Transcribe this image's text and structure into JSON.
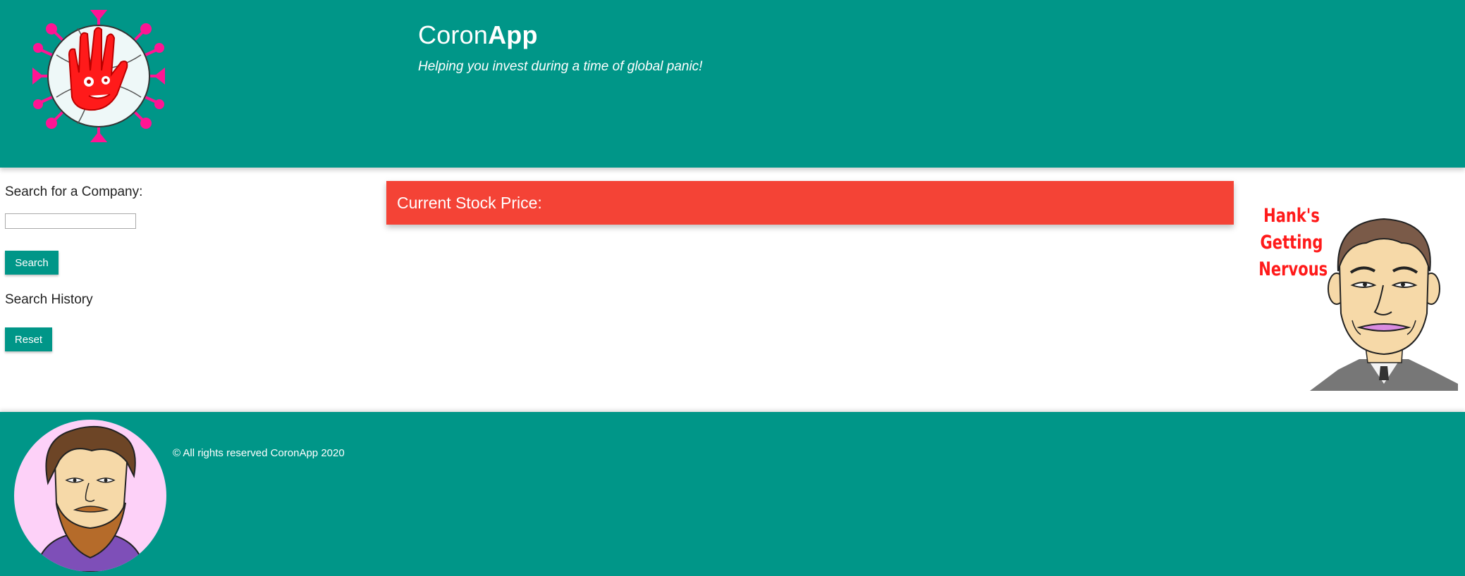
{
  "header": {
    "brand_light": "Coron",
    "brand_bold": "App",
    "tagline": "Helping you invest during a time of global panic!",
    "logo_icon": "virus-volleyball-logo-icon"
  },
  "sidebar": {
    "search_label": "Search for a Company:",
    "search_value": "",
    "search_button": "Search",
    "history_label": "Search History",
    "reset_button": "Reset"
  },
  "main": {
    "price_label": "Current Stock Price:"
  },
  "hank": {
    "caption_line1": "Hank's",
    "caption_line2": "Getting",
    "caption_line3": "Nervous",
    "image_icon": "hank-cartoon-icon"
  },
  "footer": {
    "copyright": "© All rights reserved CoronApp 2020",
    "avatar_icon": "bearded-man-avatar-icon"
  },
  "colors": {
    "teal": "#009688",
    "red_panel": "#f44336",
    "caption_red": "#ff1a1a",
    "virus_pink": "#ff1493"
  }
}
